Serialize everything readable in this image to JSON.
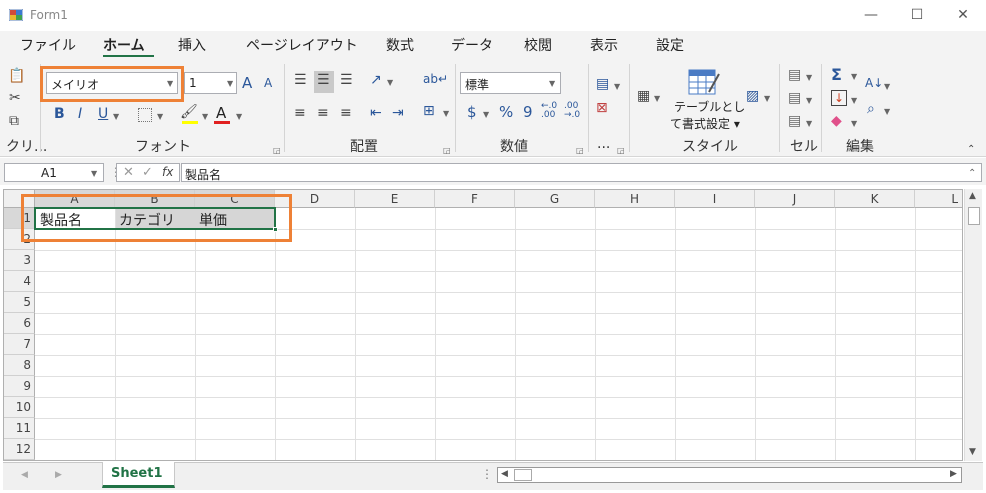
{
  "window": {
    "title": "Form1",
    "minimize": "—",
    "maximize": "☐",
    "close": "✕"
  },
  "tabs": [
    "ファイル",
    "ホーム",
    "挿入",
    "ページレイアウト",
    "数式",
    "データ",
    "校閲",
    "表示",
    "設定"
  ],
  "ribbon": {
    "font_name": "メイリオ",
    "font_size": "1",
    "number_format": "標準",
    "groups": {
      "clipboard": "クリ...",
      "font": "フォント",
      "alignment": "配置",
      "number": "数値",
      "more": "...",
      "style": "スタイル",
      "cells": "セル",
      "editing": "編集"
    },
    "table_format_line1": "テーブルとし",
    "table_format_line2": "て書式設定 ▾",
    "bold": "B",
    "italic": "I",
    "underline": "U",
    "grow_font": "A",
    "shrink_font": "A",
    "font_color": "A",
    "currency": "$",
    "percent": "%",
    "comma": "9",
    "autosum": "Σ"
  },
  "formula_bar": {
    "cell_ref": "A1",
    "fx": "fx",
    "content": "製品名"
  },
  "columns": [
    "A",
    "B",
    "C",
    "D",
    "E",
    "F",
    "G",
    "H",
    "I",
    "J",
    "K",
    "L"
  ],
  "rows": [
    "1",
    "2",
    "3",
    "4",
    "5",
    "6",
    "7",
    "8",
    "9",
    "10",
    "11",
    "12"
  ],
  "cells": {
    "A1": "製品名",
    "B1": "カテゴリ",
    "C1": "単価"
  },
  "sheet_tab": "Sheet1",
  "colors": {
    "accent": "#217346",
    "highlight": "#ee8136",
    "selection": "#d6d6d6"
  }
}
